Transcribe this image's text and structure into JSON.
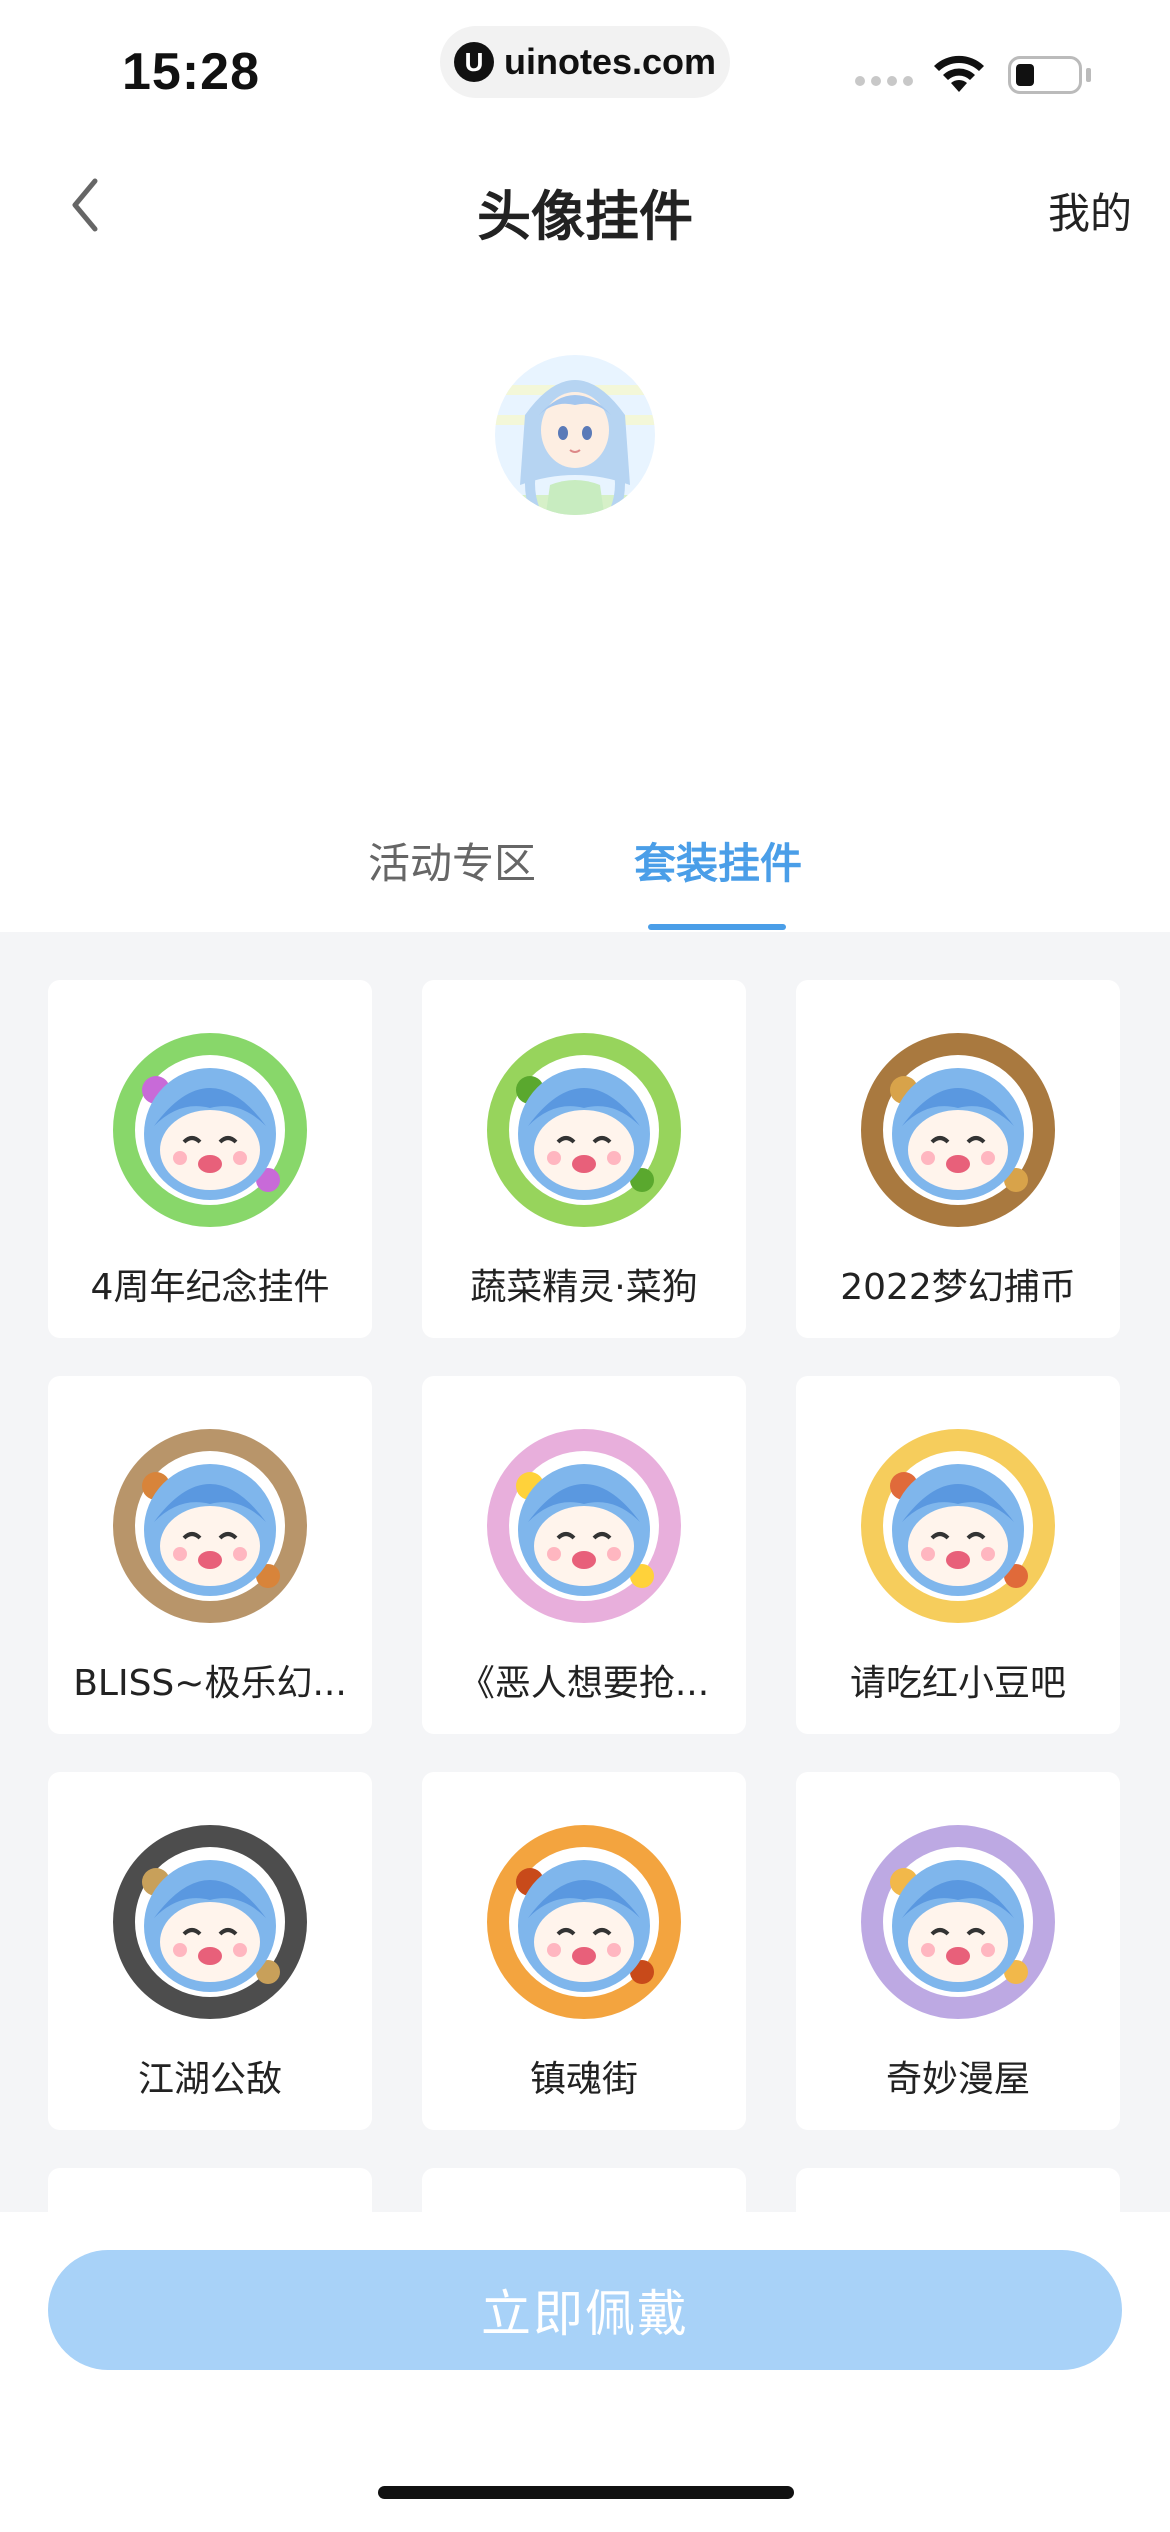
{
  "status_bar": {
    "time": "15:28",
    "url": "uinotes.com",
    "url_logo": "U"
  },
  "header": {
    "title": "头像挂件",
    "right_link": "我的",
    "back_icon": "chevron-left-icon"
  },
  "tabs": [
    {
      "label": "活动专区",
      "active": false
    },
    {
      "label": "套装挂件",
      "active": true
    }
  ],
  "pendants": [
    {
      "label": "4周年纪念挂件",
      "frame_color": "#7bd35a",
      "accent": "#c86ad8"
    },
    {
      "label": "蔬菜精灵·菜狗",
      "frame_color": "#8ccf4a",
      "accent": "#5aa82e"
    },
    {
      "label": "2022梦幻捕币",
      "frame_color": "#a06a2a",
      "accent": "#d8a34a"
    },
    {
      "label": "BLISS~极乐幻...",
      "frame_color": "#b08a5a",
      "accent": "#d8843a"
    },
    {
      "label": "《恶人想要抢...",
      "frame_color": "#e6a6d8",
      "accent": "#ffd23a"
    },
    {
      "label": "请吃红小豆吧",
      "frame_color": "#f5c84a",
      "accent": "#e06a3a"
    },
    {
      "label": "江湖公敌",
      "frame_color": "#3a3a3a",
      "accent": "#c8a05a"
    },
    {
      "label": "镇魂街",
      "frame_color": "#f29a2a",
      "accent": "#c84a1a"
    },
    {
      "label": "奇妙漫屋",
      "frame_color": "#b6a0e0",
      "accent": "#f2b84a"
    }
  ],
  "actions": {
    "wear_label": "立即佩戴"
  },
  "colors": {
    "accent": "#4a9ee8",
    "button": "#a8d2f8",
    "background": "#f4f5f7"
  }
}
